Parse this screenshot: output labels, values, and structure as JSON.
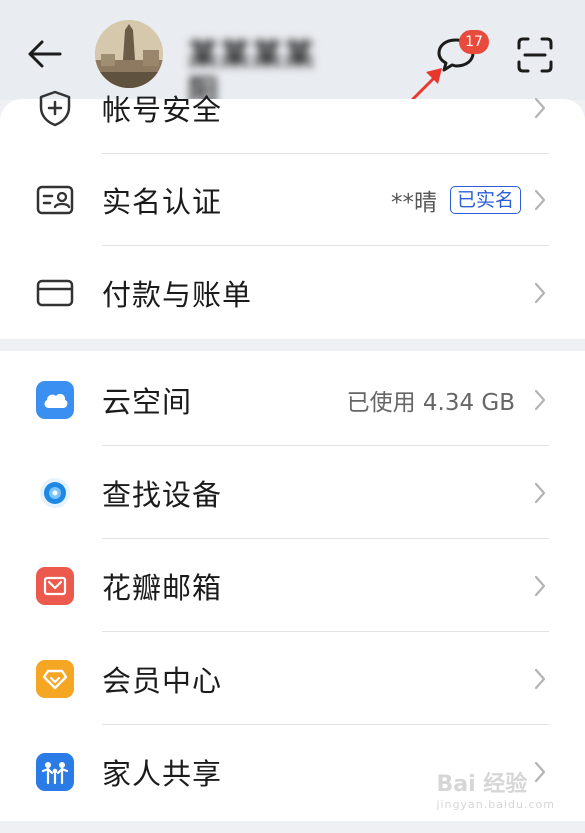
{
  "header": {
    "username": "某某某某阳",
    "message_count": "17",
    "avatar_desc": "avatar photo"
  },
  "account_section": {
    "rows": [
      {
        "label": "帐号安全",
        "icon": "shield-plus-icon"
      },
      {
        "label": "实名认证",
        "icon": "id-card-icon",
        "value": "**晴",
        "badge": "已实名"
      },
      {
        "label": "付款与账单",
        "icon": "card-icon"
      }
    ]
  },
  "services_section": {
    "rows": [
      {
        "label": "云空间",
        "icon": "cloud-icon",
        "value": "已使用 4.34 GB",
        "color": "#3a8ff0"
      },
      {
        "label": "查找设备",
        "icon": "find-device-icon",
        "color": "#1e88e5"
      },
      {
        "label": "花瓣邮箱",
        "icon": "mail-icon",
        "color": "#ec5a4d"
      },
      {
        "label": "会员中心",
        "icon": "member-diamond-icon",
        "color": "#f5a623"
      },
      {
        "label": "家人共享",
        "icon": "family-icon",
        "color": "#2a7be6"
      }
    ]
  },
  "watermark": {
    "brand": "Bai 经验",
    "sub": "jingyan.baidu.com"
  },
  "colors": {
    "badge_red": "#e84a3b",
    "verified_blue": "#2a5fd9",
    "annotation_red": "#e8372d"
  }
}
